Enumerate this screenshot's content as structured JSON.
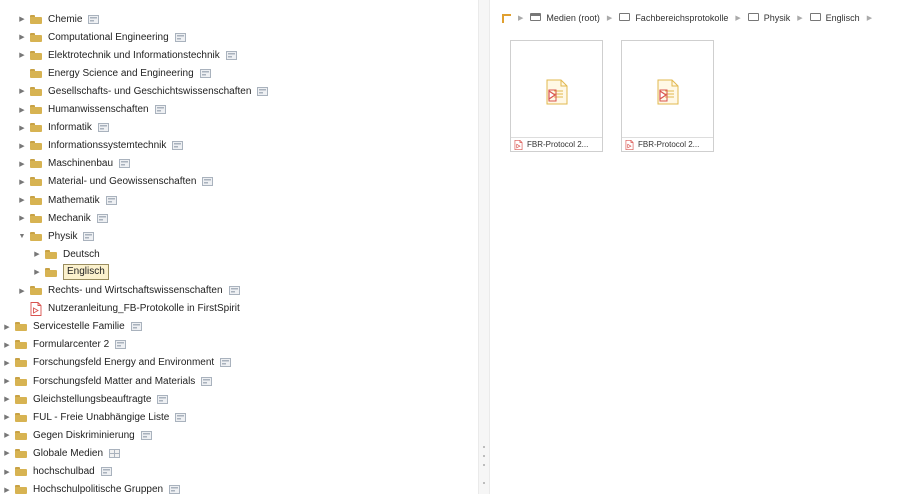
{
  "tree": {
    "rows": [
      {
        "label": "Chemie",
        "indent": 1,
        "toggle": "collapsed",
        "icon": "folder",
        "state": "flag"
      },
      {
        "label": "Computational Engineering",
        "indent": 1,
        "toggle": "collapsed",
        "icon": "folder",
        "state": "flag"
      },
      {
        "label": "Elektrotechnik und Informationstechnik",
        "indent": 1,
        "toggle": "collapsed",
        "icon": "folder",
        "state": "flag"
      },
      {
        "label": "Energy Science and Engineering",
        "indent": 1,
        "toggle": "none",
        "icon": "folder",
        "state": "flag"
      },
      {
        "label": "Gesellschafts- und Geschichtswissenschaften",
        "indent": 1,
        "toggle": "collapsed",
        "icon": "folder",
        "state": "flag"
      },
      {
        "label": "Humanwissenschaften",
        "indent": 1,
        "toggle": "collapsed",
        "icon": "folder",
        "state": "flag"
      },
      {
        "label": "Informatik",
        "indent": 1,
        "toggle": "collapsed",
        "icon": "folder",
        "state": "flag"
      },
      {
        "label": "Informationssystemtechnik",
        "indent": 1,
        "toggle": "collapsed",
        "icon": "folder",
        "state": "flag"
      },
      {
        "label": "Maschinenbau",
        "indent": 1,
        "toggle": "collapsed",
        "icon": "folder",
        "state": "flag"
      },
      {
        "label": "Material- und Geowissenschaften",
        "indent": 1,
        "toggle": "collapsed",
        "icon": "folder",
        "state": "flag"
      },
      {
        "label": "Mathematik",
        "indent": 1,
        "toggle": "collapsed",
        "icon": "folder",
        "state": "flag"
      },
      {
        "label": "Mechanik",
        "indent": 1,
        "toggle": "collapsed",
        "icon": "folder",
        "state": "flag"
      },
      {
        "label": "Physik",
        "indent": 1,
        "toggle": "expanded",
        "icon": "folder",
        "state": "flag"
      },
      {
        "label": "Deutsch",
        "indent": 2,
        "toggle": "collapsed",
        "icon": "folder",
        "state": "none"
      },
      {
        "label": "Englisch",
        "indent": 2,
        "toggle": "collapsed",
        "icon": "folder",
        "state": "none",
        "selected": true
      },
      {
        "label": "Rechts- und Wirtschaftswissenschaften",
        "indent": 1,
        "toggle": "collapsed",
        "icon": "folder",
        "state": "flag"
      },
      {
        "label": "Nutzeranleitung_FB-Protokolle in FirstSpirit",
        "indent": 1,
        "toggle": "none",
        "icon": "pdf",
        "state": "none"
      },
      {
        "label": "Servicestelle Familie",
        "indent": 0,
        "toggle": "collapsed",
        "icon": "folder",
        "state": "flag"
      },
      {
        "label": "Formularcenter 2",
        "indent": 0,
        "toggle": "collapsed",
        "icon": "folder",
        "state": "flag"
      },
      {
        "label": "Forschungsfeld Energy and Environment",
        "indent": 0,
        "toggle": "collapsed",
        "icon": "folder",
        "state": "flag"
      },
      {
        "label": "Forschungsfeld Matter and Materials",
        "indent": 0,
        "toggle": "collapsed",
        "icon": "folder",
        "state": "flag"
      },
      {
        "label": "Gleichstellungsbeauftragte",
        "indent": 0,
        "toggle": "collapsed",
        "icon": "folder",
        "state": "flag"
      },
      {
        "label": "FUL - Freie Unabhängige Liste",
        "indent": 0,
        "toggle": "collapsed",
        "icon": "folder",
        "state": "flag"
      },
      {
        "label": "Gegen Diskriminierung",
        "indent": 0,
        "toggle": "collapsed",
        "icon": "folder",
        "state": "flag"
      },
      {
        "label": "Globale Medien",
        "indent": 0,
        "toggle": "collapsed",
        "icon": "folder",
        "state": "grid"
      },
      {
        "label": "hochschulbad",
        "indent": 0,
        "toggle": "collapsed",
        "icon": "folder",
        "state": "flag"
      },
      {
        "label": "Hochschulpolitische Gruppen",
        "indent": 0,
        "toggle": "collapsed",
        "icon": "folder",
        "state": "flag"
      }
    ]
  },
  "breadcrumb": [
    {
      "label": "Medien (root)",
      "icon": "media-root-icon"
    },
    {
      "label": "Fachbereichsprotokolle",
      "icon": "folder-outline-icon"
    },
    {
      "label": "Physik",
      "icon": "folder-outline-icon"
    },
    {
      "label": "Englisch",
      "icon": "folder-outline-icon"
    }
  ],
  "files": [
    {
      "caption": "FBR-Protocol 2...",
      "icon": "pdf-file-icon"
    },
    {
      "caption": "FBR-Protocol 2...",
      "icon": "pdf-file-icon"
    }
  ],
  "colors": {
    "folder": "#d7b352",
    "pdf": "#d9534f",
    "selected_bg": "#fbf1cd"
  }
}
